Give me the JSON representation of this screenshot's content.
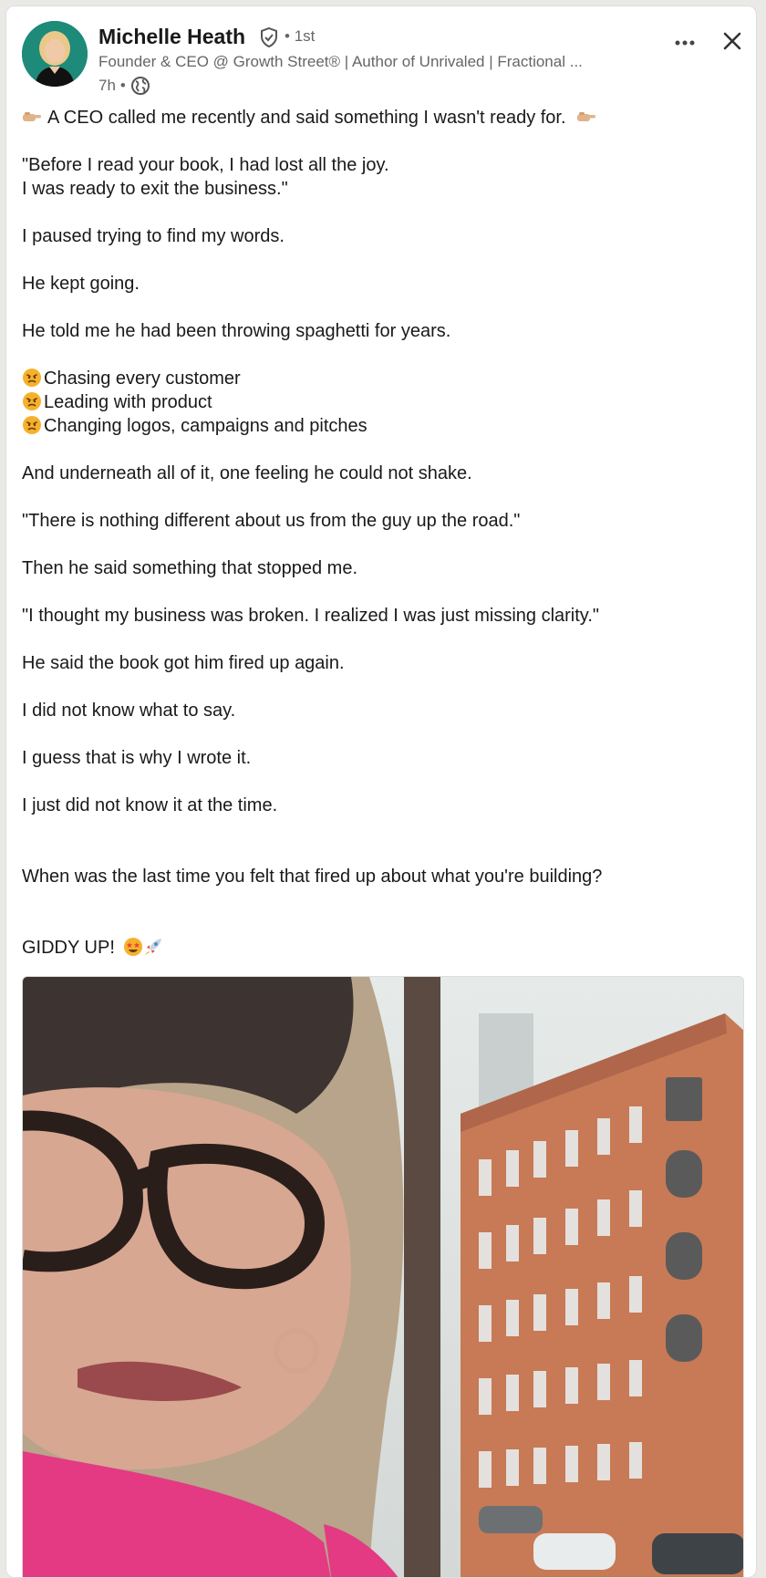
{
  "author": {
    "name": "Michelle Heath",
    "connection_degree": "1st",
    "headline": "Founder & CEO @ Growth Street® | Author of Unrivaled | Fractional ...",
    "post_age": "7h"
  },
  "header": {
    "more_icon": "more-horizontal-icon",
    "close_icon": "close-icon",
    "verified_icon": "verified-shield-icon",
    "visibility_icon": "globe-icon"
  },
  "post": {
    "opening": "A CEO called me recently and said something I wasn't ready for.",
    "p_quote_line1": "\"Before I read your book, I had lost all the joy.",
    "p_quote_line2": "I was ready to exit the business.\"",
    "p_paused": "I paused trying to find my words.",
    "p_kept_going": "He kept going.",
    "p_spaghetti": "He told me he had been throwing spaghetti for years.",
    "bullets": [
      "Chasing every customer",
      "Leading with product",
      "Changing logos, campaigns and pitches"
    ],
    "p_underneath": "And underneath all of it, one feeling he could not shake.",
    "p_nothing_different": "\"There is nothing different about us from the guy up the road.\"",
    "p_stopped_me": "Then he said something that stopped me.",
    "p_broken": "\"I thought my business was broken. I realized I was just missing clarity.\"",
    "p_fired_up": "He said the book got him fired up again.",
    "p_not_know": "I did not know what to say.",
    "p_why": "I guess that is why I wrote it.",
    "p_time": "I just did not know it at the time.",
    "p_question": "When was the last time you felt that fired up about what you're building?",
    "p_giddy": "GIDDY UP!"
  },
  "colors": {
    "brand_teal": "#1d8a7a",
    "text_primary": "#191919",
    "text_secondary": "#666666",
    "shirt_pink": "#e33a83",
    "brick": "#c77a55"
  }
}
